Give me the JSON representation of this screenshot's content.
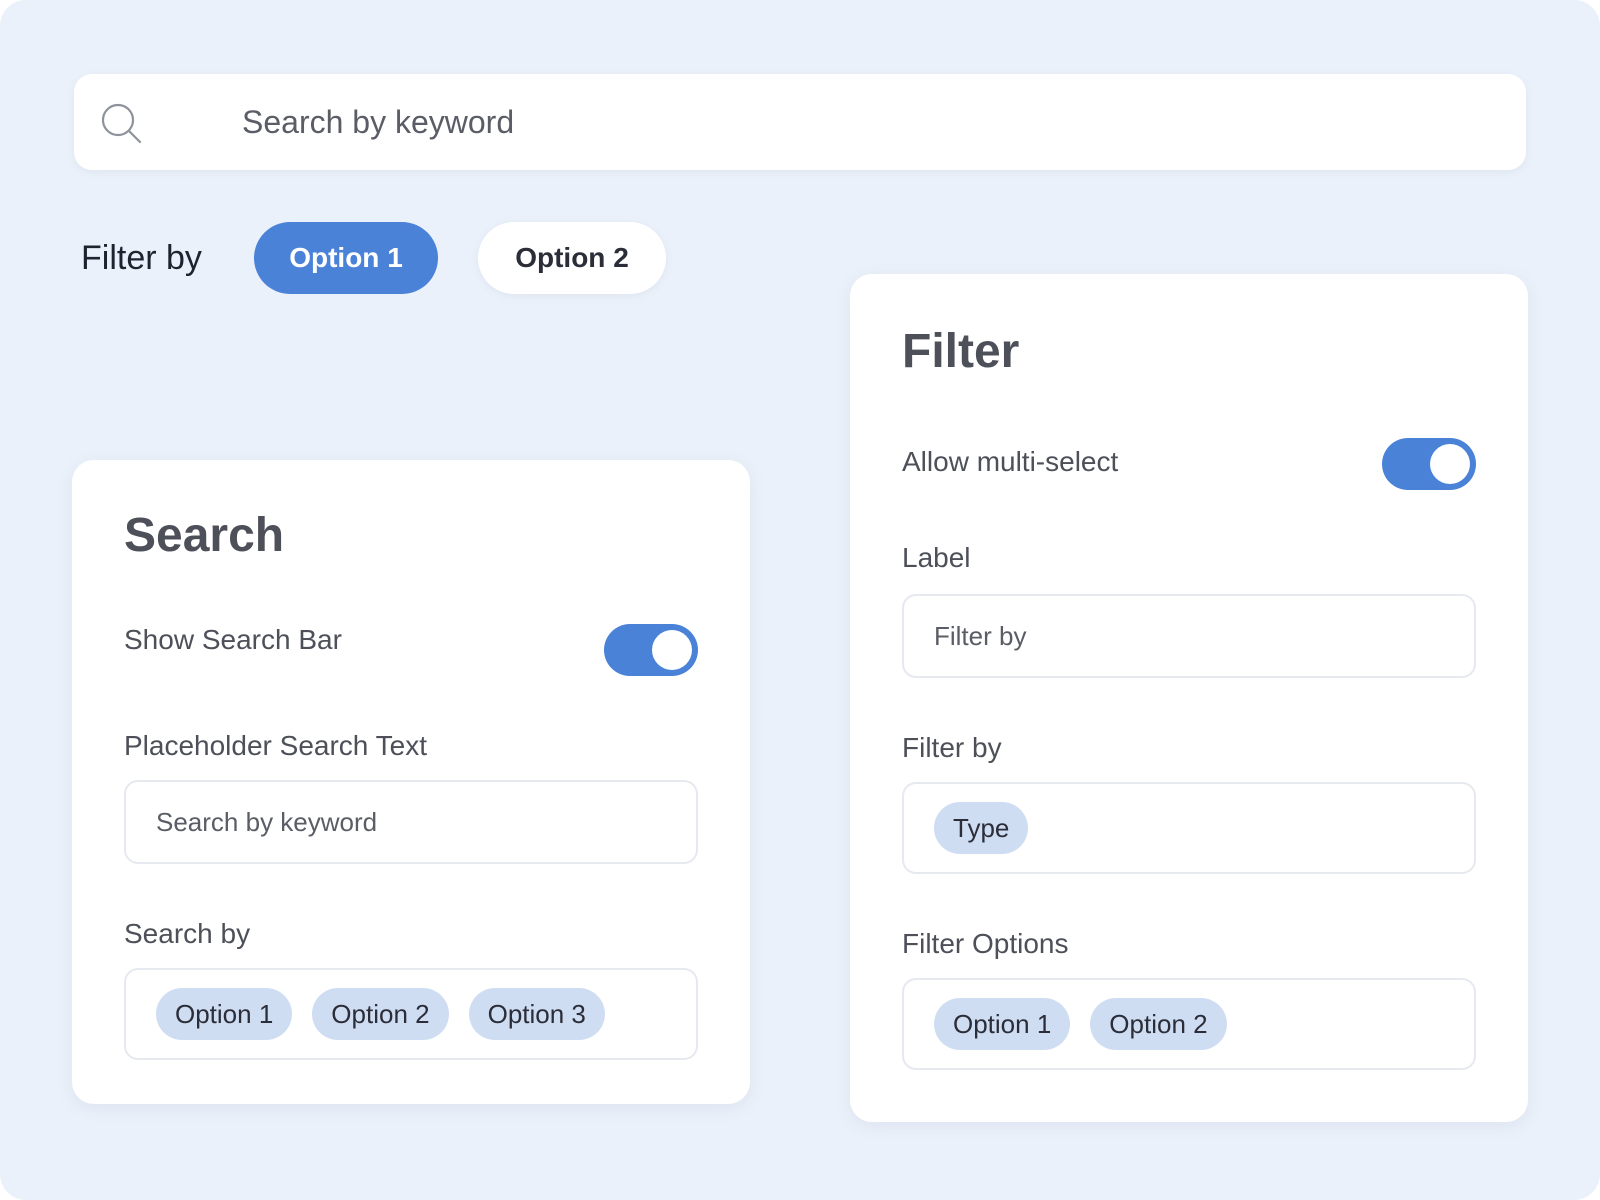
{
  "colors": {
    "background": "#ebf1fa",
    "accent": "#4a82d8",
    "chip": "#cfddf3",
    "card": "#ffffff"
  },
  "top_search": {
    "icon": "search-icon",
    "placeholder": "Search by keyword"
  },
  "filter_row": {
    "label": "Filter by",
    "options": [
      "Option 1",
      "Option 2"
    ],
    "selected": "Option 1"
  },
  "search_card": {
    "title": "Search",
    "show_search_bar_label": "Show Search Bar",
    "show_search_bar_enabled": true,
    "placeholder_label": "Placeholder Search Text",
    "placeholder_value": "Search by keyword",
    "search_by_label": "Search by",
    "search_by_chips": [
      "Option 1",
      "Option 2",
      "Option 3"
    ]
  },
  "filter_card": {
    "title": "Filter",
    "allow_multi_select_label": "Allow multi-select",
    "allow_multi_select_enabled": true,
    "label_label": "Label",
    "label_value": "Filter by",
    "filter_by_label": "Filter by",
    "filter_by_chips": [
      "Type"
    ],
    "filter_options_label": "Filter Options",
    "filter_options_chips": [
      "Option 1",
      "Option 2"
    ]
  }
}
